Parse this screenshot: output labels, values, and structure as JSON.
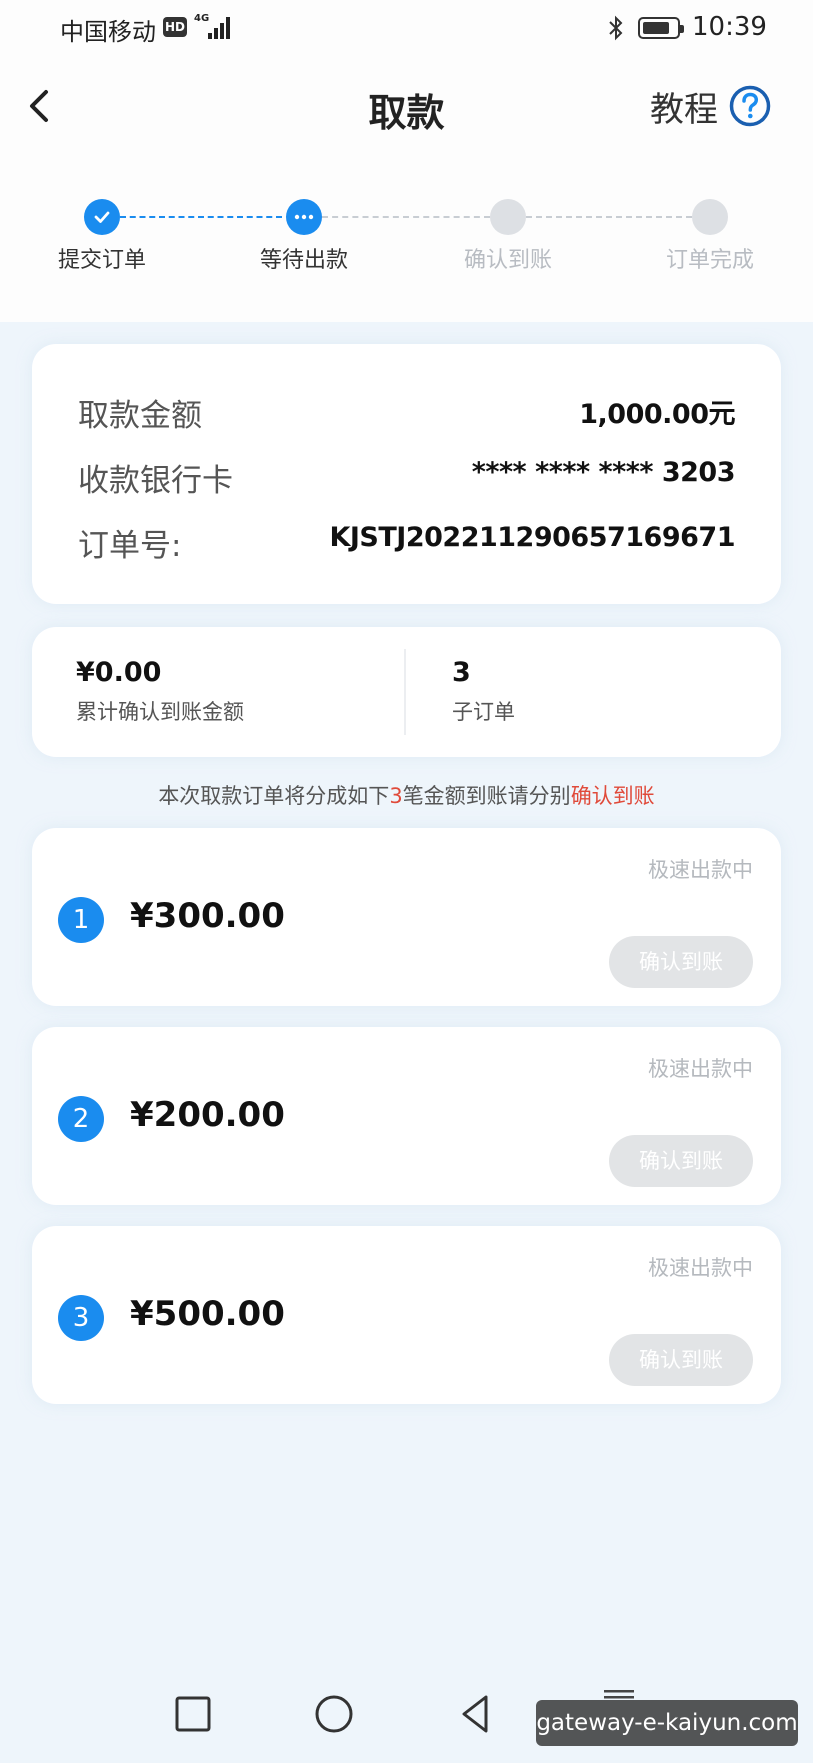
{
  "status_bar": {
    "carrier": "中国移动",
    "hd_badge": "HD",
    "network": "4G",
    "time": "10:39",
    "battery_level": 0.8
  },
  "header": {
    "title": "取款",
    "tutorial_label": "教程",
    "back_icon": "chevron-left-icon",
    "help_icon": "question-circle-icon"
  },
  "steps": [
    {
      "label": "提交订单",
      "state": "done"
    },
    {
      "label": "等待出款",
      "state": "current"
    },
    {
      "label": "确认到账",
      "state": "pending"
    },
    {
      "label": "订单完成",
      "state": "pending"
    }
  ],
  "order": {
    "amount_label": "取款金额",
    "amount_value": "1,000.00元",
    "card_label": "收款银行卡",
    "card_value": "**** **** **** 3203",
    "order_no_label": "订单号:",
    "order_no_value": "KJSTJ2022112906571696​71"
  },
  "summary": {
    "confirmed_amount": "¥0.00",
    "confirmed_label": "累计确认到账金额",
    "sub_order_count": "3",
    "sub_order_label": "子订单"
  },
  "notice": {
    "prefix": "本次取款订单将分成如下",
    "count": "3",
    "middle": "笔金额到账请分别",
    "action": "确认到账"
  },
  "sub_orders": [
    {
      "index": "1",
      "amount": "¥300.00",
      "status": "极速出款中",
      "button_label": "确认到账"
    },
    {
      "index": "2",
      "amount": "¥200.00",
      "status": "极速出款中",
      "button_label": "确认到账"
    },
    {
      "index": "3",
      "amount": "¥500.00",
      "status": "极速出款中",
      "button_label": "确认到账"
    }
  ],
  "watermark": "gateway-e-kaiyun.com",
  "colors": {
    "accent": "#1a8cef",
    "highlight": "#e04a3a",
    "disabled_button": "#e2e4e6"
  }
}
